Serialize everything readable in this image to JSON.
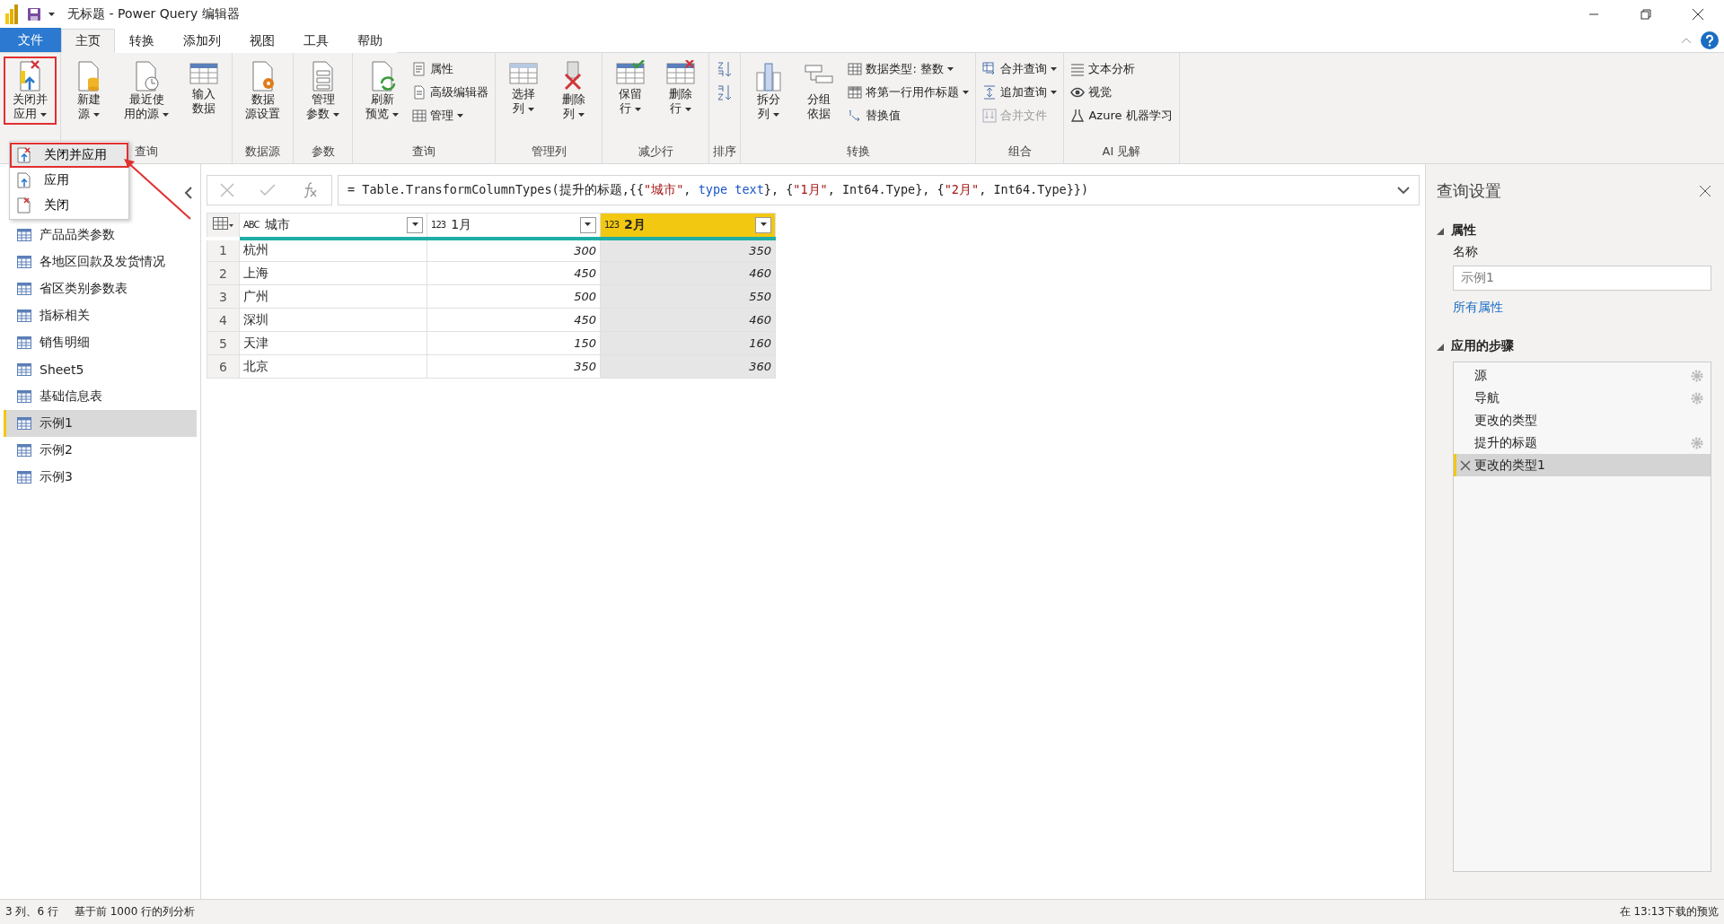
{
  "window": {
    "title": "无标题 - Power Query 编辑器"
  },
  "tabs": [
    {
      "label": "文件",
      "kind": "file",
      "selected": false
    },
    {
      "label": "主页",
      "kind": "tab",
      "selected": true
    },
    {
      "label": "转换",
      "kind": "tab",
      "selected": false
    },
    {
      "label": "添加列",
      "kind": "tab",
      "selected": false
    },
    {
      "label": "视图",
      "kind": "tab",
      "selected": false
    },
    {
      "label": "工具",
      "kind": "tab",
      "selected": false
    },
    {
      "label": "帮助",
      "kind": "tab",
      "selected": false
    }
  ],
  "ribbon": [
    {
      "items": [
        {
          "kind": "large",
          "lines": [
            "关闭并",
            "应用"
          ],
          "dropdown": true,
          "highlighted": true
        }
      ]
    },
    {
      "label": "查询",
      "items": [
        {
          "kind": "large",
          "lines": [
            "新建",
            "源"
          ],
          "dropdown": true
        },
        {
          "kind": "large",
          "lines": [
            "最近使",
            "用的源"
          ],
          "dropdown": true
        },
        {
          "kind": "large",
          "lines": [
            "输入",
            "数据"
          ],
          "dropdown": false
        }
      ]
    },
    {
      "label": "数据源",
      "items": [
        {
          "kind": "large",
          "lines": [
            "数据",
            "源设置"
          ],
          "dropdown": false
        }
      ]
    },
    {
      "label": "参数",
      "items": [
        {
          "kind": "large",
          "lines": [
            "管理",
            "参数"
          ],
          "dropdown": true
        }
      ]
    },
    {
      "label": "查询",
      "items": [
        {
          "kind": "large",
          "lines": [
            "刷新",
            "预览"
          ],
          "dropdown": true
        },
        {
          "kind": "small",
          "text": "属性",
          "dropdown": false,
          "disabled": false
        },
        {
          "kind": "small",
          "text": "高级编辑器",
          "dropdown": false,
          "disabled": false
        },
        {
          "kind": "small",
          "text": "管理",
          "dropdown": true,
          "disabled": false
        }
      ]
    },
    {
      "label": "管理列",
      "items": [
        {
          "kind": "large",
          "lines": [
            "选择",
            "列"
          ],
          "dropdown": true
        },
        {
          "kind": "large",
          "lines": [
            "删除",
            "列"
          ],
          "dropdown": true
        }
      ]
    },
    {
      "label": "减少行",
      "items": [
        {
          "kind": "large",
          "lines": [
            "保留",
            "行"
          ],
          "dropdown": true
        },
        {
          "kind": "large",
          "lines": [
            "删除",
            "行"
          ],
          "dropdown": true
        }
      ]
    },
    {
      "label": "排序",
      "items": [
        {
          "kind": "icon"
        },
        {
          "kind": "icon"
        }
      ]
    },
    {
      "label": "转换",
      "items": [
        {
          "kind": "large",
          "lines": [
            "拆分",
            "列"
          ],
          "dropdown": true
        },
        {
          "kind": "large",
          "lines": [
            "分组",
            "依据"
          ],
          "dropdown": false
        },
        {
          "kind": "small",
          "text": "数据类型: 整数",
          "dropdown": true,
          "disabled": false
        },
        {
          "kind": "small",
          "text": "将第一行用作标题",
          "dropdown": true,
          "disabled": false
        },
        {
          "kind": "small",
          "text": "替换值",
          "dropdown": false,
          "disabled": false
        }
      ]
    },
    {
      "label": "组合",
      "items": [
        {
          "kind": "small",
          "text": "合并查询",
          "dropdown": true,
          "disabled": false
        },
        {
          "kind": "small",
          "text": "追加查询",
          "dropdown": true,
          "disabled": false
        },
        {
          "kind": "small",
          "text": "合并文件",
          "dropdown": false,
          "disabled": true
        }
      ]
    },
    {
      "label": "AI 见解",
      "items": [
        {
          "kind": "small",
          "text": "文本分析",
          "dropdown": false,
          "disabled": false
        },
        {
          "kind": "small",
          "text": "视觉",
          "dropdown": false,
          "disabled": false
        },
        {
          "kind": "small",
          "text": "Azure 机器学习",
          "dropdown": false,
          "disabled": false
        }
      ]
    }
  ],
  "dropdown_menu": [
    {
      "label": "关闭并应用",
      "highlighted": true
    },
    {
      "label": "应用",
      "highlighted": false
    },
    {
      "label": "关闭",
      "highlighted": false
    }
  ],
  "queries": [
    {
      "name": "产品品类参数",
      "selected": false
    },
    {
      "name": "各地区回款及发货情况",
      "selected": false
    },
    {
      "name": "省区类别参数表",
      "selected": false
    },
    {
      "name": "指标相关",
      "selected": false
    },
    {
      "name": "销售明细",
      "selected": false
    },
    {
      "name": "Sheet5",
      "selected": false
    },
    {
      "name": "基础信息表",
      "selected": false
    },
    {
      "name": "示例1",
      "selected": true
    },
    {
      "name": "示例2",
      "selected": false
    },
    {
      "name": "示例3",
      "selected": false
    }
  ],
  "formula": [
    {
      "kind": "code",
      "text": "= Table.TransformColumnTypes(提升的标题,{{"
    },
    {
      "kind": "string",
      "text": "\"城市\""
    },
    {
      "kind": "code",
      "text": ", "
    },
    {
      "kind": "keyword",
      "text": "type text"
    },
    {
      "kind": "code",
      "text": "}, {"
    },
    {
      "kind": "string",
      "text": "\"1月\""
    },
    {
      "kind": "code",
      "text": ", Int64.Type}, {"
    },
    {
      "kind": "string",
      "text": "\"2月\""
    },
    {
      "kind": "code",
      "text": ", Int64.Type}})"
    }
  ],
  "table": {
    "columns": [
      {
        "label": "城市",
        "type_label": "ABC",
        "kind": "text",
        "selected": false
      },
      {
        "label": "1月",
        "type_label": "123",
        "kind": "number",
        "selected": false
      },
      {
        "label": "2月",
        "type_label": "123",
        "kind": "number",
        "selected": true
      }
    ],
    "rows": [
      {
        "index": "1",
        "cells": [
          "杭州",
          "300",
          "350"
        ]
      },
      {
        "index": "2",
        "cells": [
          "上海",
          "450",
          "460"
        ]
      },
      {
        "index": "3",
        "cells": [
          "广州",
          "500",
          "550"
        ]
      },
      {
        "index": "4",
        "cells": [
          "深圳",
          "450",
          "460"
        ]
      },
      {
        "index": "5",
        "cells": [
          "天津",
          "150",
          "160"
        ]
      },
      {
        "index": "6",
        "cells": [
          "北京",
          "350",
          "360"
        ]
      }
    ]
  },
  "settings": {
    "title": "查询设置",
    "properties": {
      "heading": "属性",
      "expanded": true,
      "name_label": "名称",
      "name_value": "示例1",
      "link": "所有属性"
    },
    "steps_heading": "应用的步骤",
    "steps_expanded": true,
    "steps": [
      {
        "name": "源",
        "gear": true,
        "selected": false
      },
      {
        "name": "导航",
        "gear": true,
        "selected": false
      },
      {
        "name": "更改的类型",
        "gear": false,
        "selected": false
      },
      {
        "name": "提升的标题",
        "gear": true,
        "selected": false
      },
      {
        "name": "更改的类型1",
        "gear": false,
        "selected": true
      }
    ]
  },
  "status_bar": {
    "left": [
      "3 列、6 行",
      "基于前 1000 行的列分析"
    ],
    "right": "在 13:13下载的预览"
  }
}
